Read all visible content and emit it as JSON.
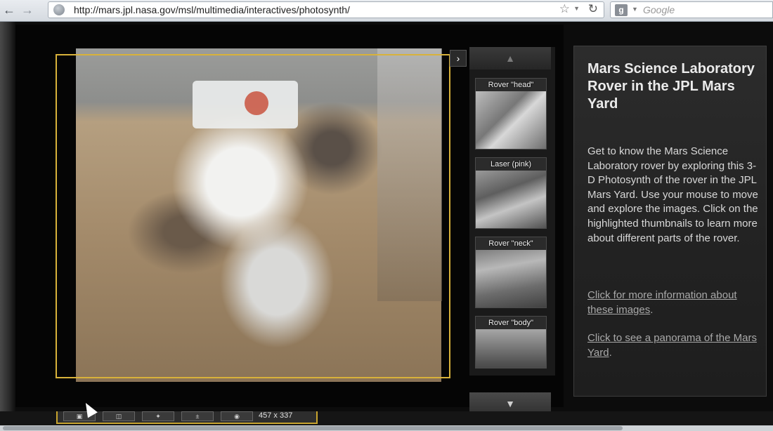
{
  "browser": {
    "url": "http://mars.jpl.nasa.gov/msl/multimedia/interactives/photosynth/",
    "search_placeholder": "Google",
    "icons": {
      "back": "back-arrow-icon",
      "forward": "forward-arrow-icon",
      "site": "globe-icon",
      "bookmark": "star-icon",
      "reload": "reload-icon",
      "search_engine": "google-icon"
    }
  },
  "viewer": {
    "collapse_glyph": "›",
    "thumbnails": [
      {
        "label": "Rover \"head\""
      },
      {
        "label": "Laser (pink)"
      },
      {
        "label": "Rover \"neck\""
      },
      {
        "label": "Rover \"body\""
      }
    ],
    "up_glyph": "▲",
    "down_glyph": "▼",
    "controls": {
      "size_readout": "457 x 337"
    }
  },
  "info": {
    "title": "Mars Science Laboratory Rover in the JPL Mars Yard",
    "description": "Get to know the Mars Science Laboratory rover by exploring this 3-D Photosynth of the rover in the JPL Mars Yard. Use your mouse to move and explore the images. Click on the highlighted thumbnails to learn more about different parts of the rover.",
    "link_more": "Click for more information about these images",
    "link_panorama": "Click to see a panorama of the Mars Yard",
    "period": "."
  },
  "colors": {
    "highlight": "#d8b23a",
    "panel_bg": "#2c2c2c"
  }
}
